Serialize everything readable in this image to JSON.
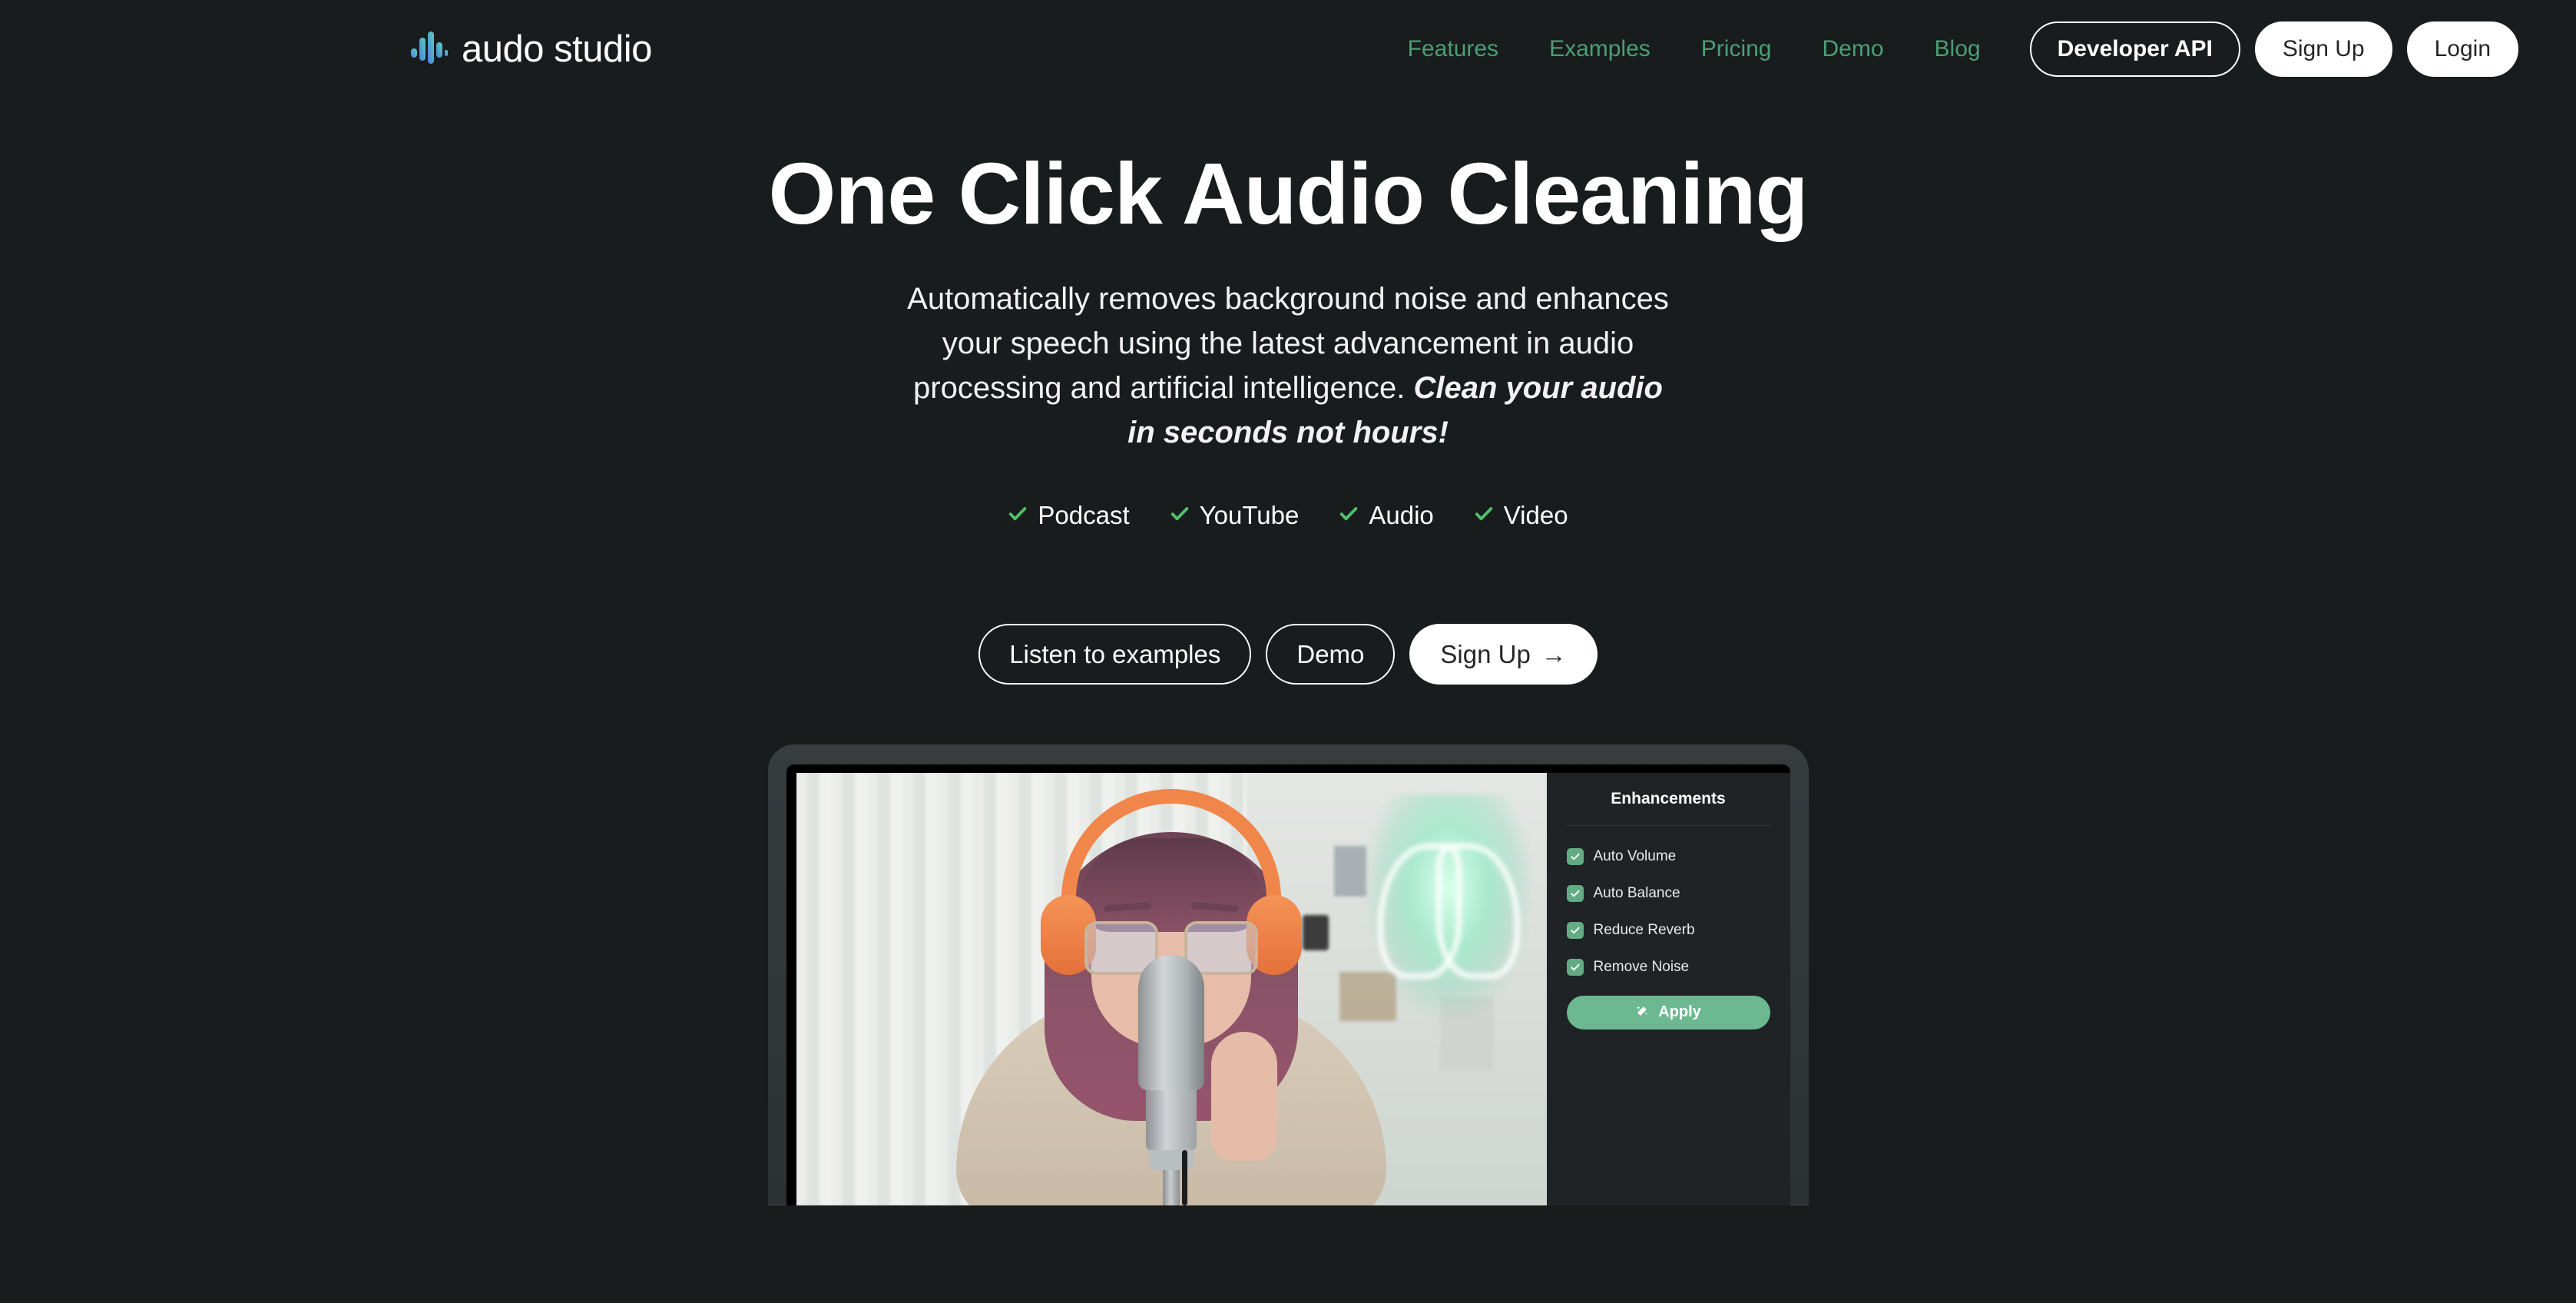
{
  "theme": {
    "background": "#181c1d",
    "nav_link_color": "#4b9e74",
    "check_green": "#4ec16a",
    "panel_green": "#6bb891",
    "checkbox_green": "#62ab83",
    "logo_gradient_from": "#4a7fe0",
    "logo_gradient_to": "#5ecfb8"
  },
  "header": {
    "brand_name": "audo studio",
    "nav_links": [
      {
        "label": "Features"
      },
      {
        "label": "Examples"
      },
      {
        "label": "Pricing"
      },
      {
        "label": "Demo"
      },
      {
        "label": "Blog"
      }
    ],
    "developer_api_label": "Developer API",
    "sign_up_label": "Sign Up",
    "login_label": "Login"
  },
  "hero": {
    "title": "One Click Audio Cleaning",
    "subtitle_plain": "Automatically removes background noise and enhances your speech using the latest advancement in audio processing and artificial intelligence. ",
    "subtitle_emphasis": "Clean your audio in seconds not hours!",
    "feature_tags": [
      {
        "label": "Podcast"
      },
      {
        "label": "YouTube"
      },
      {
        "label": "Audio"
      },
      {
        "label": "Video"
      }
    ],
    "cta_listen_label": "Listen to examples",
    "cta_demo_label": "Demo",
    "cta_signup_label": "Sign Up",
    "cta_signup_arrow": "→"
  },
  "mockup": {
    "panel_title": "Enhancements",
    "enhancements": [
      {
        "label": "Auto Volume",
        "checked": true
      },
      {
        "label": "Auto Balance",
        "checked": true
      },
      {
        "label": "Reduce Reverb",
        "checked": true
      },
      {
        "label": "Remove Noise",
        "checked": true
      }
    ],
    "apply_label": "Apply"
  }
}
